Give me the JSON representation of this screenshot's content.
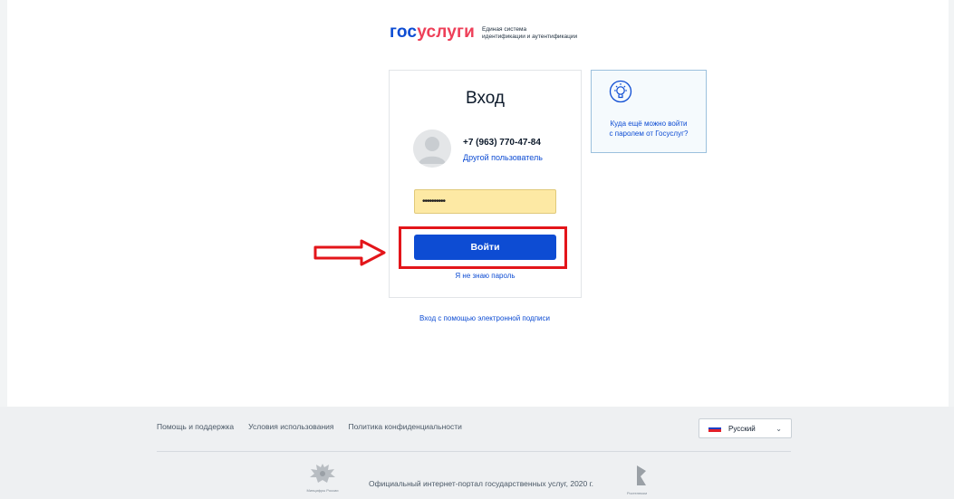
{
  "header": {
    "logo_gos": "гос",
    "logo_uslugi": "услуги",
    "logo_sub_line1": "Единая система",
    "logo_sub_line2": "идентификации и аутентификации"
  },
  "login": {
    "title": "Вход",
    "phone": "+7 (963) 770-47-84",
    "other_user": "Другой пользователь",
    "password_value": "••••••••••",
    "login_button": "Войти",
    "forgot_password": "Я не знаю пароль"
  },
  "info": {
    "line1": "Куда ещё можно войти",
    "line2": "с паролем от Госуслуг?"
  },
  "digital_signature_link": "Вход с помощью электронной подписи",
  "footer": {
    "links": [
      "Помощь и поддержка",
      "Условия использования",
      "Политика конфиденциальности"
    ],
    "language": "Русский",
    "portal_text": "Официальный интернет-портал государственных услуг, 2020 г.",
    "emblem_caption": "Минцифры России",
    "rtk_caption": "Ростелеком"
  },
  "colors": {
    "accent": "#0d4cd3",
    "brand_red": "#ee3f58",
    "highlight": "#e3151a",
    "password_bg": "#fde9a4"
  },
  "icons": {
    "avatar": "user-avatar-icon",
    "info": "lightbulb-icon",
    "arrow": "arrow-right-icon",
    "emblem": "coat-of-arms-icon",
    "rtk": "rostelecom-logo-icon",
    "chevron": "chevron-down-icon"
  }
}
